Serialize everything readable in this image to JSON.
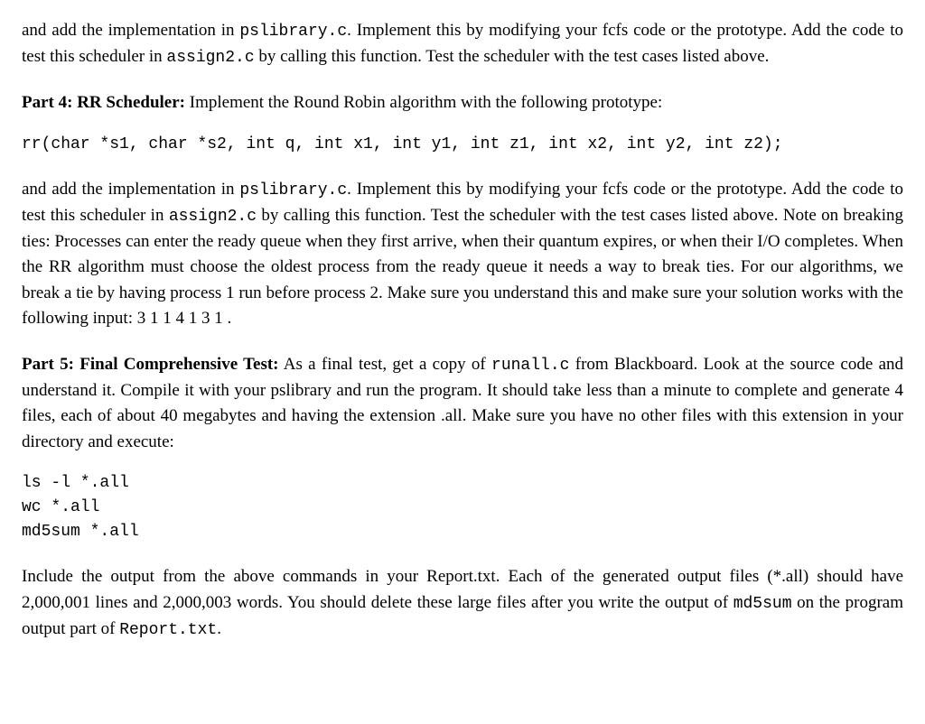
{
  "intro": {
    "p1_a": "and add the implementation in ",
    "p1_code1": "pslibrary.c",
    "p1_b": ". Implement this by modifying your fcfs code or the prototype. Add the code to test this scheduler in ",
    "p1_code2": "assign2.c",
    "p1_c": " by calling this function. Test the scheduler with the test cases listed above."
  },
  "part4": {
    "heading": "Part 4: RR Scheduler:",
    "lead": " Implement the Round Robin algorithm with the following prototype:",
    "prototype": "rr(char *s1, char *s2, int q, int x1, int y1, int z1, int x2, int y2, int z2);",
    "body_a": "and add the implementation in ",
    "body_code1": "pslibrary.c",
    "body_b": ". Implement this by modifying your fcfs code or the prototype. Add the code to test this scheduler in ",
    "body_code2": "assign2.c",
    "body_c": " by calling this function. Test the scheduler with the test cases listed above. Note on breaking ties: Processes can enter the ready queue when they first arrive, when their quantum expires, or when their I/O completes. When the RR algorithm must choose the oldest process from the ready queue it needs a way to break ties. For our algorithms, we break a tie by having process 1 run before process 2. Make sure you understand this and make sure your solution works with the following input: 3 1 1 4 1 3 1 ."
  },
  "part5": {
    "heading": "Part 5: Final Comprehensive Test:",
    "body_a": " As a final test, get a copy of ",
    "body_code1": "runall.c",
    "body_b": " from Blackboard. Look at the source code and understand it. Compile it with your pslibrary and run the program. It should take less than a minute to complete and generate 4 files, each of about 40 megabytes and having the extension .all. Make sure you have no other files with this extension in your directory and execute:",
    "commands": "ls -l *.all\nwc *.all\nmd5sum *.all",
    "out_a": "Include the output from the above commands in your Report.txt. Each of the generated output files (*.all) should have 2,000,001 lines and 2,000,003 words. You should delete these large files after you write the output of ",
    "out_code1": "md5sum",
    "out_b": " on the program output part of ",
    "out_code2": "Report.txt",
    "out_c": "."
  }
}
